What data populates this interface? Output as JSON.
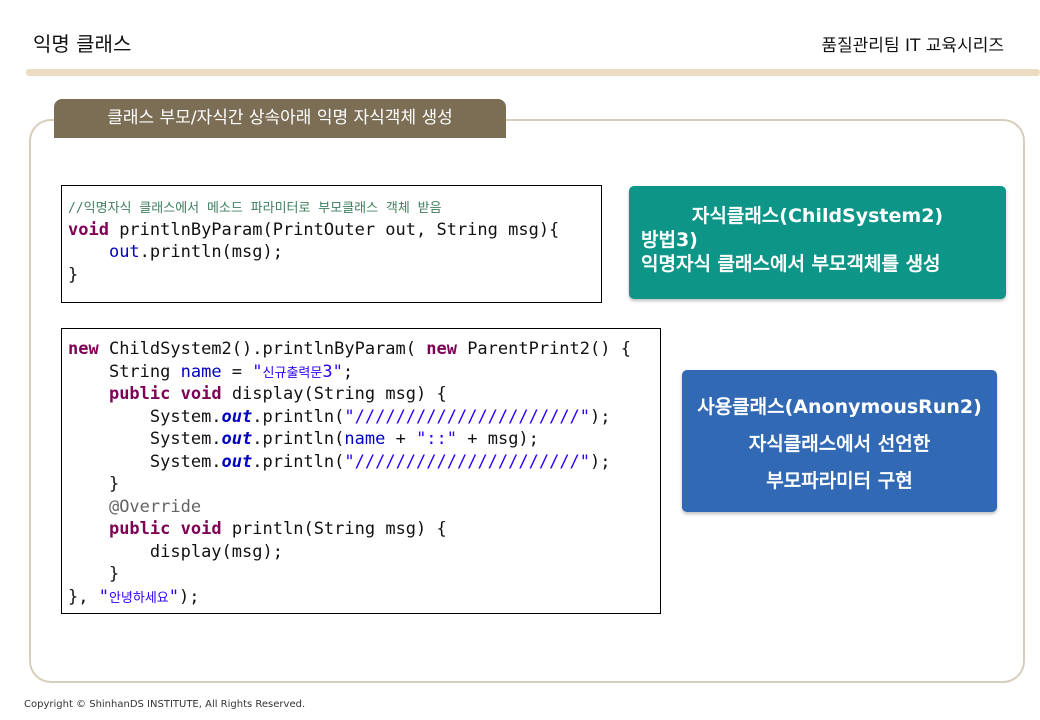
{
  "header": {
    "title": "익명 클래스",
    "series": "품질관리팀 IT 교육시리즈"
  },
  "section_label": "클래스 부모/자식간 상속아래 익명 자식객체 생성",
  "code_block_1": {
    "comment": "//익명자식 클래스에서 메소드 파라미터로 부모클래스 객체 받음",
    "kw_void": "void",
    "sig_rest": " printlnByParam(PrintOuter out, String msg){",
    "indent": "    ",
    "out_field": "out",
    "println_call": ".println(msg);",
    "close": "}"
  },
  "code_block_2": {
    "kw_new": "new",
    "l1_mid": " ChildSystem2().printlnByParam( ",
    "l1_end": " ParentPrint2() {",
    "i1": "    ",
    "i2": "        ",
    "l2_a": "String ",
    "l2_field": "name",
    "l2_b": " = ",
    "l2_str_open": "\"",
    "l2_str_korean": "신규출력문",
    "l2_str_close": "3\"",
    "l2_end": ";",
    "kw_public": "public",
    "kw_void": "void",
    "l3_rest": " display(String msg) {",
    "system": "System.",
    "static_out": "out",
    "println_open": ".println(",
    "slashes_str": "\"//////////////////////\"",
    "println_close": ");",
    "l5_field": "name",
    "l5_mid": " + ",
    "l5_str": "\"::\"",
    "l5_end": " + msg);",
    "close_brace": "}",
    "annotation": "@Override",
    "l9_rest": " println(String msg) {",
    "l10": "display(msg);",
    "last_a": "}, ",
    "last_str_open": "\"",
    "last_str_korean": "안녕하세요",
    "last_str_close": "\"",
    "last_end": ");"
  },
  "card_child": {
    "line1": "자식클래스(ChildSystem2)",
    "line2": "방법3)",
    "line3": "익명자식 클래스에서 부모객체를 생성",
    "color": "#0d9688"
  },
  "card_user": {
    "line1": "사용클래스(AnonymousRun2)",
    "line2": "자식클래스에서 선언한",
    "line3": "부모파라미터 구현",
    "color": "#3169b5"
  },
  "footer": {
    "copyright": "Copyright © ShinhanDS INSTITUTE, All Rights Reserved."
  },
  "colors": {
    "accent_bar": "#ecdcc2",
    "section_label_bg": "#7c6d55",
    "frame_border": "#d6ceba"
  }
}
